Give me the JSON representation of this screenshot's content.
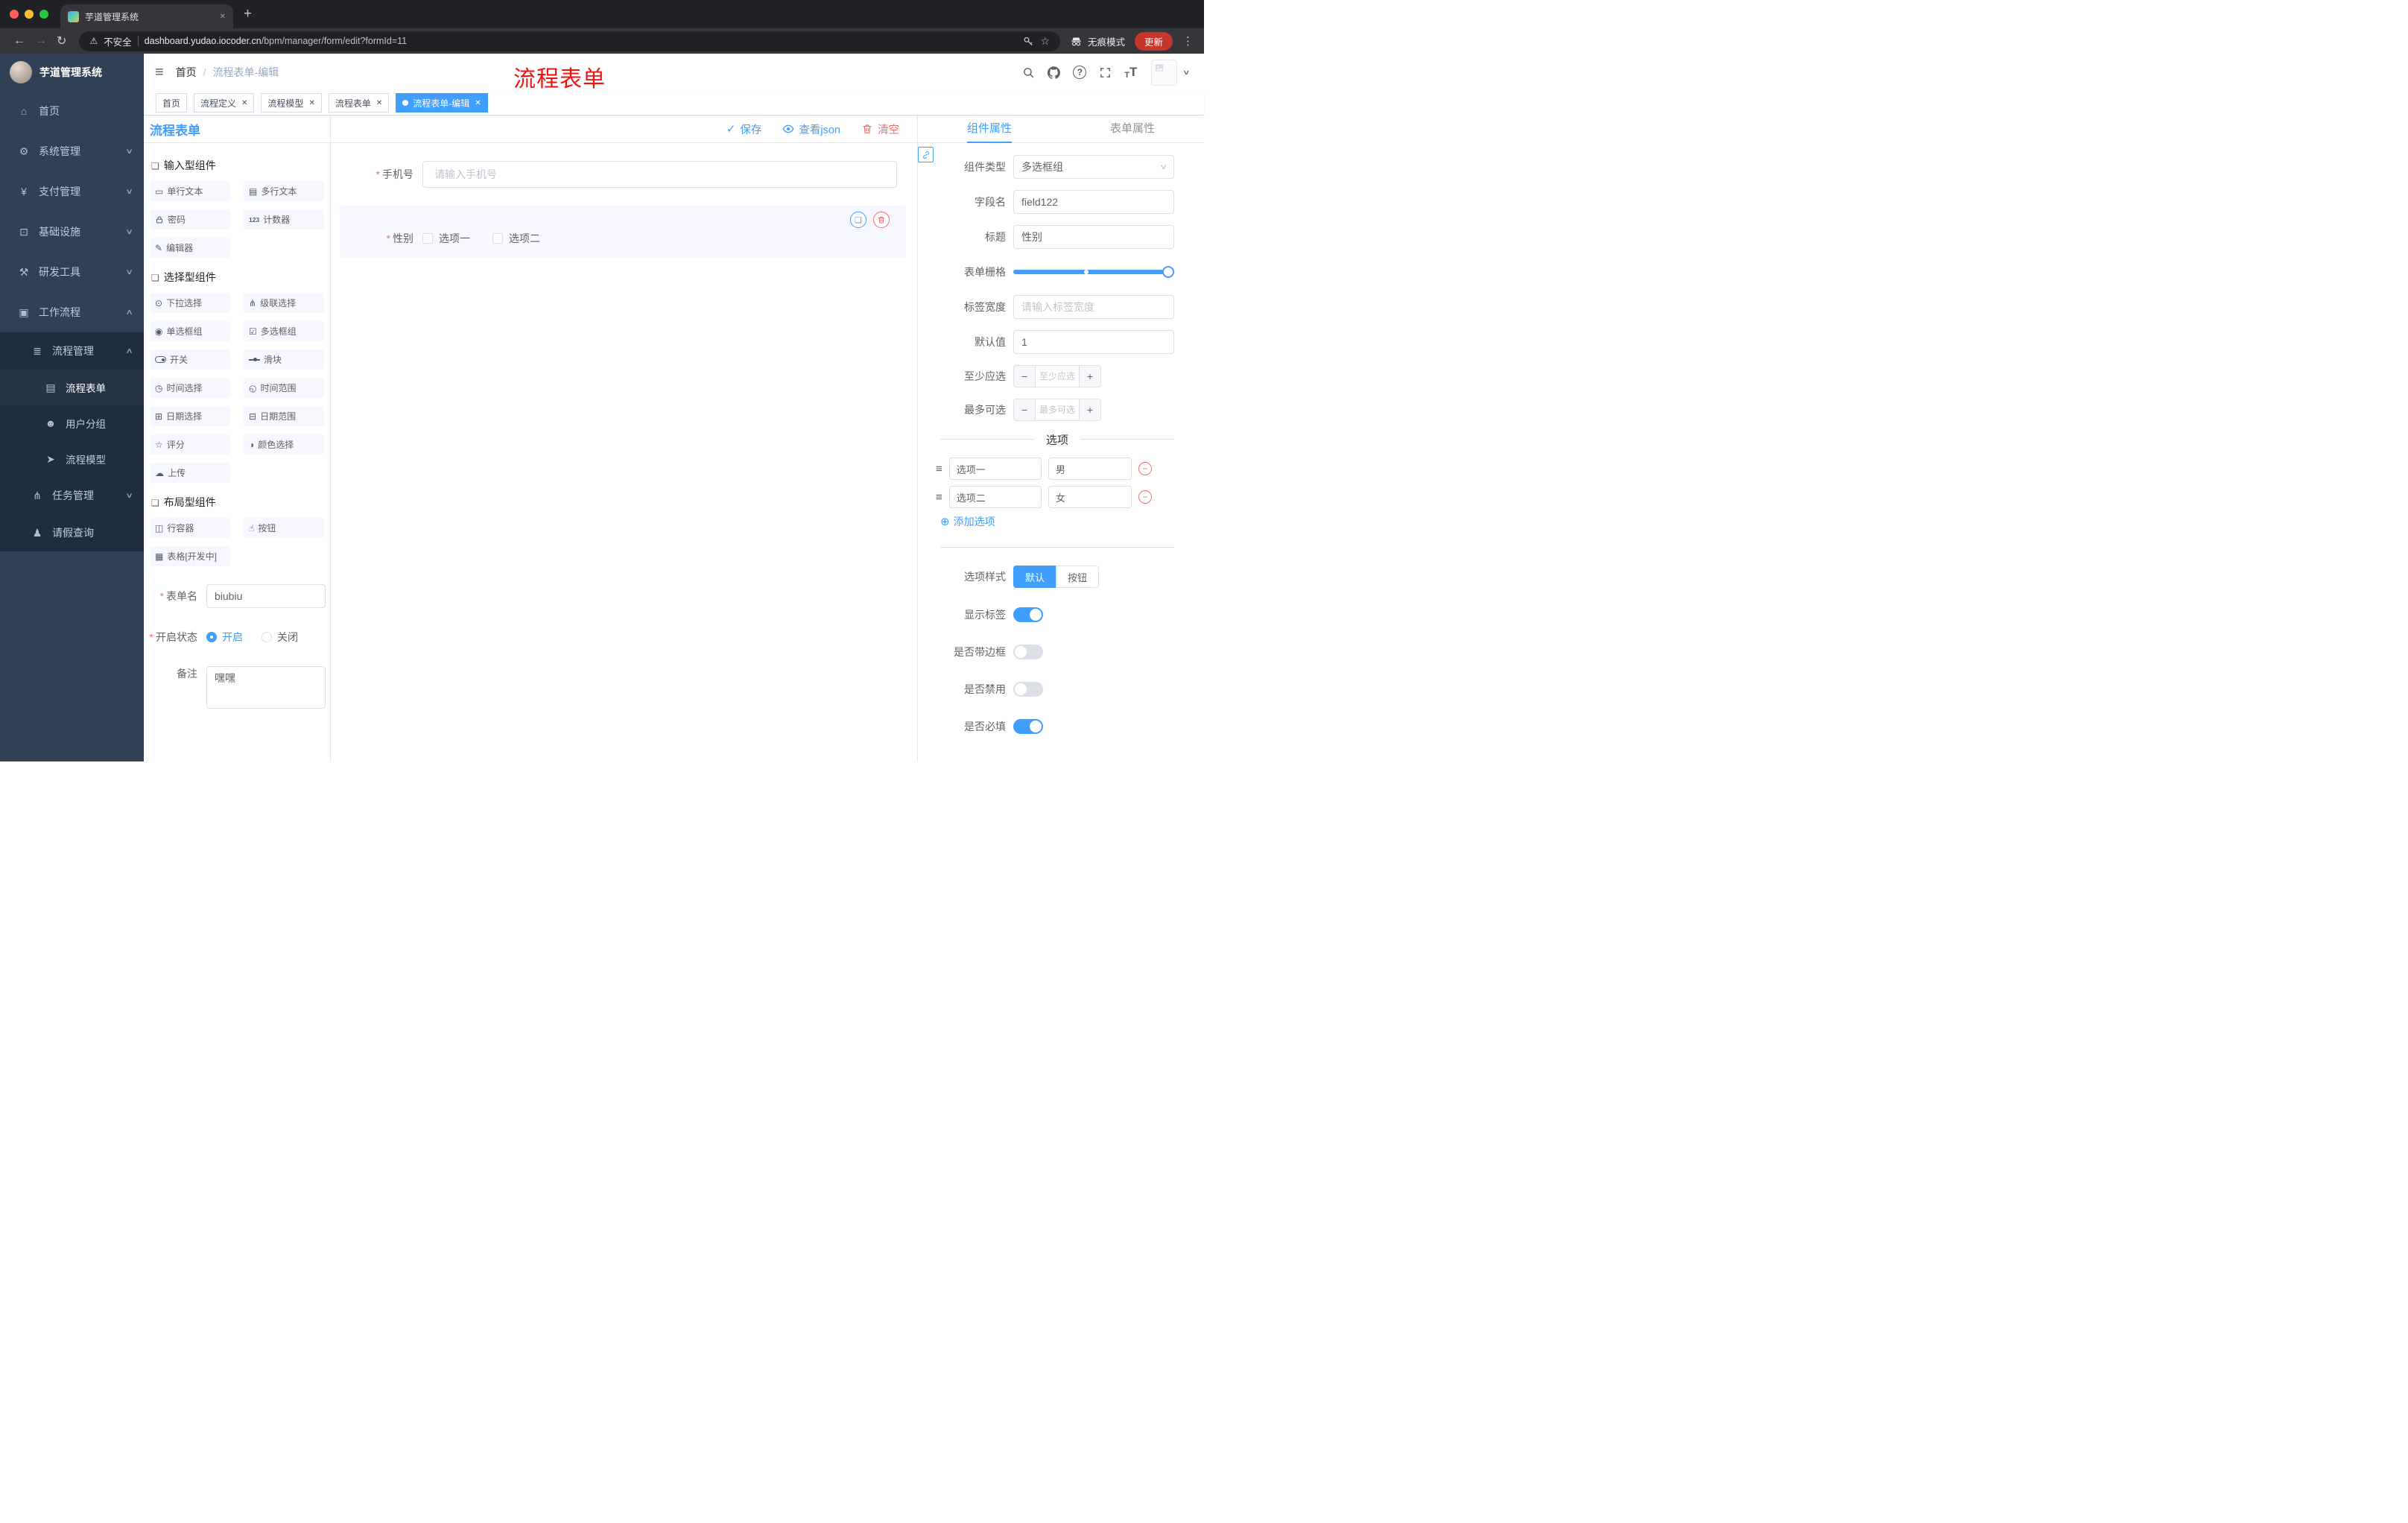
{
  "browser": {
    "tab_title": "芋道管理系统",
    "security_label": "不安全",
    "url_host": "dashboard.yudao.iocoder.cn",
    "url_path": "/bpm/manager/form/edit?formId=11",
    "incognito_label": "无痕模式",
    "update_label": "更新"
  },
  "sidebar": {
    "logo_title": "芋道管理系统",
    "menu": [
      {
        "name": "home",
        "label": "首页",
        "icon": "home-icon"
      },
      {
        "name": "system-management",
        "label": "系统管理",
        "icon": "gear-icon",
        "chevron": "down"
      },
      {
        "name": "payment-management",
        "label": "支付管理",
        "icon": "yen-icon",
        "chevron": "down"
      },
      {
        "name": "infrastructure",
        "label": "基础设施",
        "icon": "monitor-icon",
        "chevron": "down"
      },
      {
        "name": "dev-tools",
        "label": "研发工具",
        "icon": "tool-icon",
        "chevron": "down"
      },
      {
        "name": "workflow",
        "label": "工作流程",
        "icon": "workflow-icon",
        "chevron": "up",
        "open": true
      }
    ],
    "submenu": [
      {
        "name": "process-management",
        "label": "流程管理",
        "icon": "list-icon",
        "chevron": "up",
        "level": 2
      },
      {
        "name": "process-form",
        "label": "流程表单",
        "icon": "form-icon",
        "level": 3,
        "active": true
      },
      {
        "name": "user-group",
        "label": "用户分组",
        "icon": "users-icon",
        "level": 3
      },
      {
        "name": "process-model",
        "label": "流程模型",
        "icon": "send-icon",
        "level": 3
      },
      {
        "name": "task-management",
        "label": "任务管理",
        "icon": "tree-icon",
        "chevron": "down",
        "level": 2
      },
      {
        "name": "leave-query",
        "label": "请假查询",
        "icon": "user-icon",
        "level": 2
      }
    ]
  },
  "header": {
    "breadcrumb_home": "首页",
    "breadcrumb_current": "流程表单-编辑",
    "annotation": "流程表单"
  },
  "tags_view": [
    {
      "name": "home",
      "label": "首页",
      "closable": false
    },
    {
      "name": "process-definition",
      "label": "流程定义",
      "closable": true
    },
    {
      "name": "process-model",
      "label": "流程模型",
      "closable": true
    },
    {
      "name": "process-form",
      "label": "流程表单",
      "closable": true
    },
    {
      "name": "process-form-edit",
      "label": "流程表单-编辑",
      "closable": true,
      "active": true
    }
  ],
  "designer": {
    "title": "流程表单",
    "actions": {
      "save": "保存",
      "view_json": "查看json",
      "clear": "清空"
    },
    "palette": [
      {
        "title": "输入型组件",
        "items": [
          {
            "name": "single-line-text",
            "label": "单行文本",
            "icon": "single-line-text-icon"
          },
          {
            "name": "multi-line-text",
            "label": "多行文本",
            "icon": "multi-line-text-icon"
          },
          {
            "name": "password",
            "label": "密码",
            "icon": "lock-icon"
          },
          {
            "name": "counter",
            "label": "计数器",
            "icon": "counter-icon"
          },
          {
            "name": "editor",
            "label": "编辑器",
            "icon": "editor-icon"
          }
        ]
      },
      {
        "title": "选择型组件",
        "items": [
          {
            "name": "select",
            "label": "下拉选择",
            "icon": "dropdown-icon"
          },
          {
            "name": "cascader",
            "label": "级联选择",
            "icon": "cascade-icon"
          },
          {
            "name": "radio-group",
            "label": "单选框组",
            "icon": "radio-icon"
          },
          {
            "name": "checkbox-group",
            "label": "多选框组",
            "icon": "checkbox-icon"
          },
          {
            "name": "switch",
            "label": "开关",
            "icon": "switch-icon"
          },
          {
            "name": "slider",
            "label": "滑块",
            "icon": "slider-icon"
          },
          {
            "name": "time-picker",
            "label": "时间选择",
            "icon": "time-icon"
          },
          {
            "name": "time-range",
            "label": "时间范围",
            "icon": "time-range-icon"
          },
          {
            "name": "date-picker",
            "label": "日期选择",
            "icon": "date-icon"
          },
          {
            "name": "date-range",
            "label": "日期范围",
            "icon": "date-range-icon"
          },
          {
            "name": "rate",
            "label": "评分",
            "icon": "star-icon"
          },
          {
            "name": "color-picker",
            "label": "颜色选择",
            "icon": "color-icon"
          },
          {
            "name": "upload",
            "label": "上传",
            "icon": "upload-icon"
          }
        ]
      },
      {
        "title": "布局型组件",
        "items": [
          {
            "name": "row-container",
            "label": "行容器",
            "icon": "row-icon"
          },
          {
            "name": "button",
            "label": "按钮",
            "icon": "button-icon"
          },
          {
            "name": "table",
            "label": "表格[开发中]",
            "icon": "table-icon"
          }
        ]
      }
    ],
    "meta": {
      "form_name_label": "表单名",
      "form_name_value": "biubiu",
      "status_label": "开启状态",
      "status_on": "开启",
      "status_off": "关闭",
      "status_value": "开启",
      "remark_label": "备注",
      "remark_value": "嘿嘿"
    }
  },
  "canvas": {
    "phone": {
      "label": "手机号",
      "required": true,
      "placeholder": "请输入手机号"
    },
    "gender": {
      "label": "性别",
      "required": true,
      "options": [
        "选项一",
        "选项二"
      ],
      "selected": true
    }
  },
  "props": {
    "tabs": [
      {
        "name": "component-props",
        "label": "组件属性",
        "active": true
      },
      {
        "name": "form-props",
        "label": "表单属性"
      }
    ],
    "fields": {
      "component_type": {
        "label": "组件类型",
        "value": "多选框组"
      },
      "field_name": {
        "label": "字段名",
        "value": "field122"
      },
      "title": {
        "label": "标题",
        "value": "性别"
      },
      "grid": {
        "label": "表单栅格"
      },
      "label_width": {
        "label": "标签宽度",
        "placeholder": "请输入标签宽度"
      },
      "default_value": {
        "label": "默认值",
        "value": "1"
      },
      "min_select": {
        "label": "至少应选",
        "placeholder": "至少应选"
      },
      "max_select": {
        "label": "最多可选",
        "placeholder": "最多可选"
      }
    },
    "options_section": {
      "title": "选项",
      "options": [
        {
          "label": "选项一",
          "value": "男"
        },
        {
          "label": "选项二",
          "value": "女"
        }
      ],
      "add_label": "添加选项"
    },
    "style_row": {
      "label": "选项样式",
      "options": [
        "默认",
        "按钮"
      ],
      "value": "默认"
    },
    "switches": [
      {
        "name": "show-label",
        "label": "显示标签",
        "on": true
      },
      {
        "name": "with-border",
        "label": "是否带边框",
        "on": false
      },
      {
        "name": "disabled",
        "label": "是否禁用",
        "on": false
      },
      {
        "name": "required",
        "label": "是否必填",
        "on": true
      }
    ]
  },
  "colors": {
    "accent": "#409eff",
    "danger": "#f56c6c",
    "sidebar_bg": "#304156",
    "annotation": "#f21111",
    "active_tag": "#409eff"
  }
}
